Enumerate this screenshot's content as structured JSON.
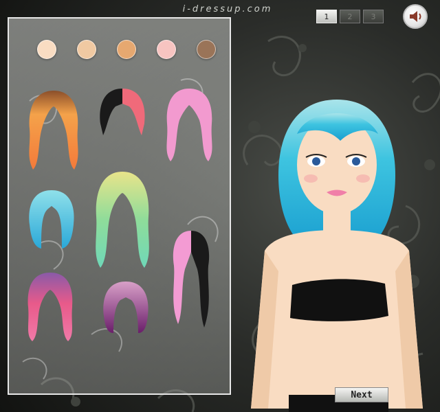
{
  "header": {
    "site_title": "i-dressup.com",
    "steps": [
      "1",
      "2",
      "3"
    ],
    "active_step": "1"
  },
  "colors": {
    "skin_tones": [
      "#f9dcc2",
      "#f0c9a2",
      "#e6a870",
      "#f7c4c1",
      "#9a7458"
    ],
    "current_hair": "#3ec4e0",
    "panel_border": "#e8e8e8"
  },
  "hair_options": [
    {
      "name": "orange-wavy-hair"
    },
    {
      "name": "black-pink-bob-hair"
    },
    {
      "name": "pink-wavy-hair"
    },
    {
      "name": "blue-bob-hair"
    },
    {
      "name": "green-pastel-long-hair"
    },
    {
      "name": "pink-black-curly-hair"
    },
    {
      "name": "purple-pink-curly-hair"
    },
    {
      "name": "purple-bob-hair"
    }
  ],
  "controls": {
    "next_label": "Next",
    "sound_icon": "speaker-icon"
  }
}
